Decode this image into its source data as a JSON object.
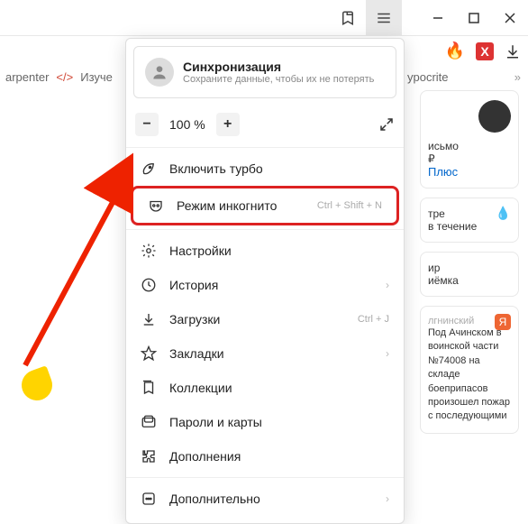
{
  "topbar": {},
  "tabs": {
    "item1": "arpenter",
    "item2": "Изуче",
    "item3": "ypocrite"
  },
  "sync": {
    "title": "Синхронизация",
    "subtitle": "Сохраните данные, чтобы их не потерять"
  },
  "zoom": {
    "minus": "−",
    "value": "100 %",
    "plus": "+"
  },
  "menu": {
    "turbo": "Включить турбо",
    "incognito": {
      "label": "Режим инкогнито",
      "shortcut": "Ctrl + Shift + N"
    },
    "settings": "Настройки",
    "history": "История",
    "downloads": {
      "label": "Загрузки",
      "shortcut": "Ctrl + J"
    },
    "bookmarks": "Закладки",
    "collections": "Коллекции",
    "passwords": "Пароли и карты",
    "addons": "Дополнения",
    "more": "Дополнительно"
  },
  "side": {
    "mail": "исьмо",
    "price": "₽",
    "plus": "Плюс",
    "weather1": "тре",
    "weather2": "в течение",
    "card3a": "ир",
    "card3b": "иёмка",
    "news_region": "лгнинский",
    "news": "Под Ачинском в воинской части №74008 на складе боеприпасов произошел пожар с последующими"
  }
}
